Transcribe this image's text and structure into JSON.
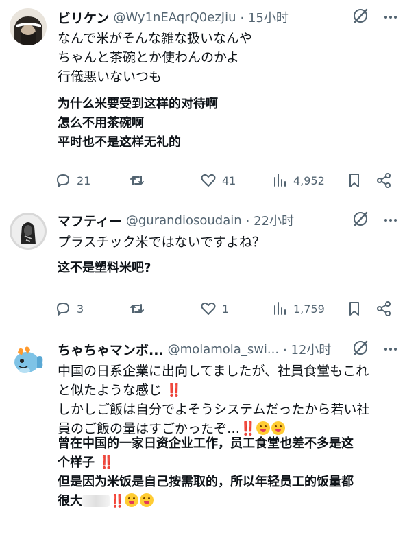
{
  "tweets": [
    {
      "name": "ビリケン",
      "handle": "@Wy1nEAqrQ0ezJiu",
      "time": "· 15小时",
      "text": [
        "なんで米がそんな雑な扱いなんや",
        "ちゃんと茶碗とか使わんのかよ",
        "行儀悪いないつも"
      ],
      "translation": [
        "为什么米要受到这样的对待啊",
        "怎么不用茶碗啊",
        "平时也不是这样无礼的"
      ],
      "replies": "21",
      "retweets": "",
      "likes": "41",
      "views": "4,952"
    },
    {
      "name": "マフティー",
      "handle": "@gurandiosoudain",
      "time": "· 22小时",
      "text": [
        "プラスチック米ではないですよね？"
      ],
      "translation": [
        "这不是塑料米吧?"
      ],
      "replies": "3",
      "retweets": "",
      "likes": "1",
      "views": "1,759"
    },
    {
      "name": "ちゃちゃマンボ...",
      "handle": "@molamola_swi...",
      "time": "· 12小时",
      "text": [
        "中国の日系企業に出向してましたが、社員食堂もこれ",
        "と似たような感じ",
        "しかしご飯は自分でよそうシステムだったから若い社",
        "員のご飯の量はすごかったぞ…"
      ],
      "translation": [
        "曾在中国的一家日资企业工作，员工食堂也差不多是这",
        "个样子",
        "但是因为米饭是自己按需取的，所以年轻员工的饭量都",
        "很大"
      ],
      "bang": "‼️",
      "emoji": "😋"
    }
  ],
  "colors": {
    "text": "#0f1419",
    "muted": "#536471",
    "divider": "#eff3f4",
    "emphasis_red": "#e0245e"
  },
  "icons": [
    "grok-icon",
    "more-icon",
    "reply-icon",
    "retweet-icon",
    "like-icon",
    "views-icon",
    "bookmark-icon",
    "share-icon"
  ]
}
